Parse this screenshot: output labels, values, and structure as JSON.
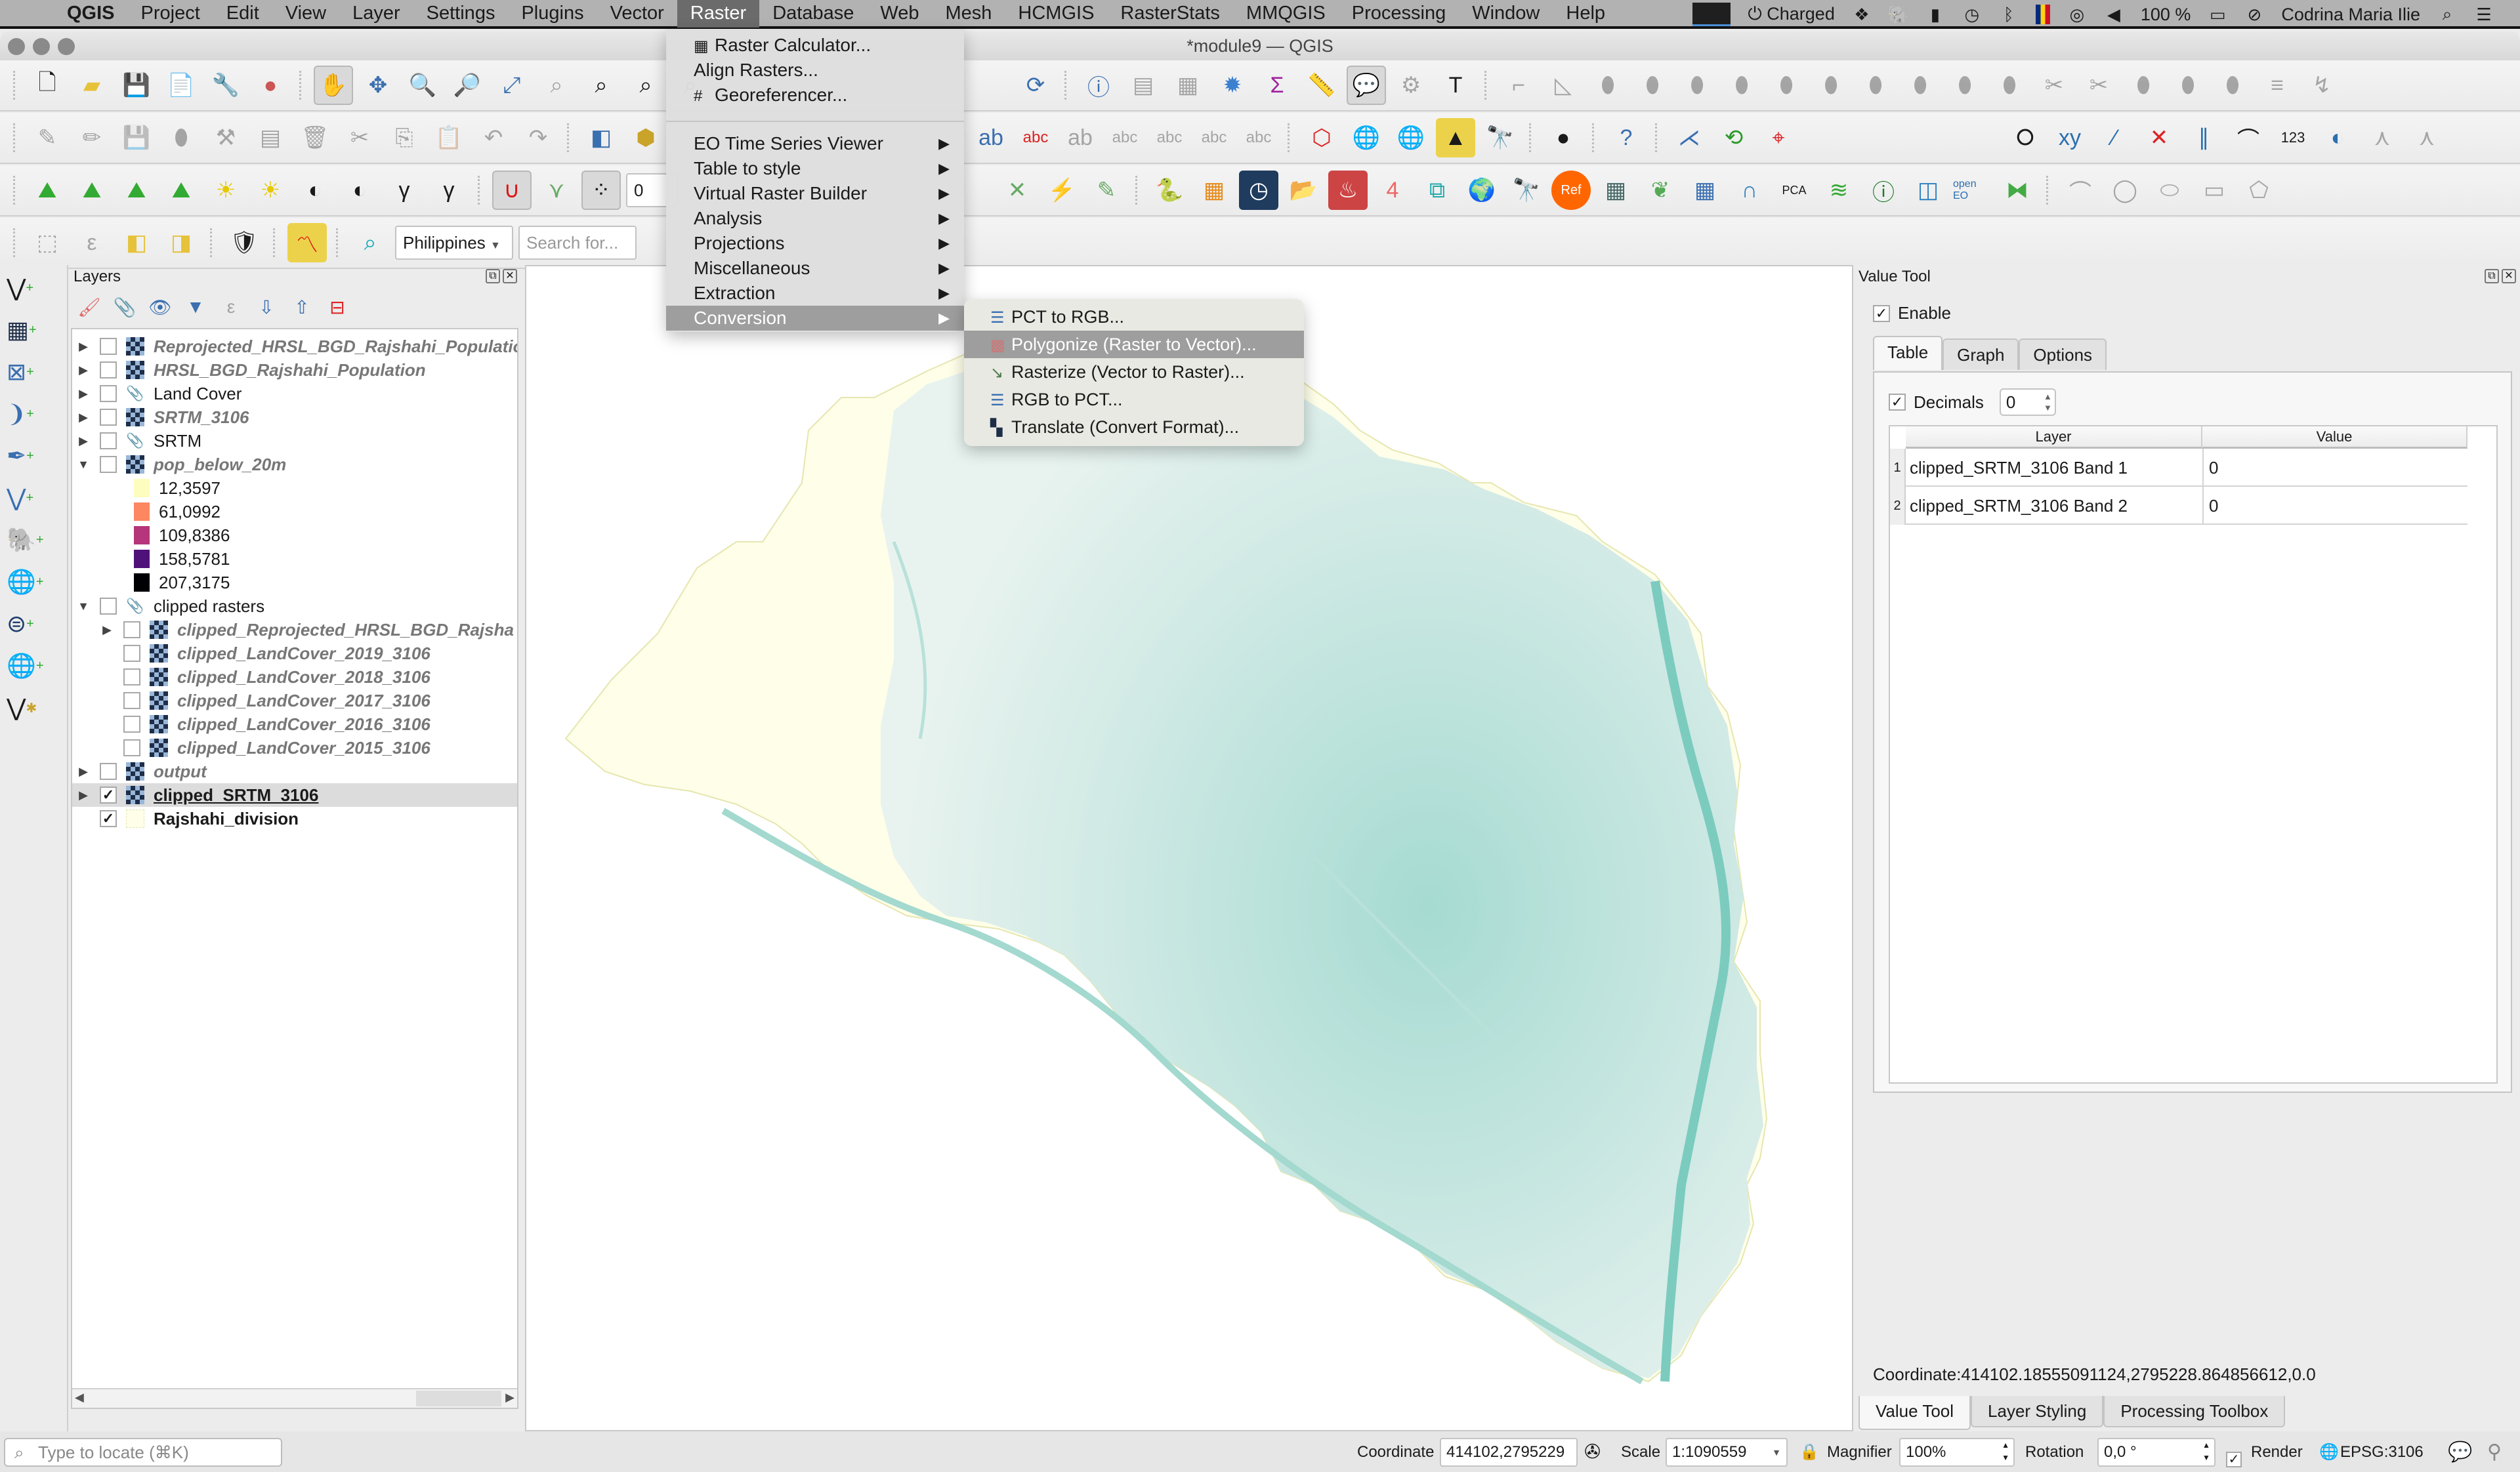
{
  "menubar": {
    "app": "QGIS",
    "items": [
      "Project",
      "Edit",
      "View",
      "Layer",
      "Settings",
      "Plugins",
      "Vector",
      "Raster",
      "Database",
      "Web",
      "Mesh",
      "HCMGIS",
      "RasterStats",
      "MMQGIS",
      "Processing",
      "Window",
      "Help"
    ],
    "active": "Raster",
    "tray": {
      "battery_status": "Charged",
      "battery_pct": "100 %",
      "user": "Codrina Maria Ilie"
    }
  },
  "window": {
    "title": "*module9 — QGIS"
  },
  "toolbar": {
    "locator_country": "Philippines",
    "search_placeholder": "Search for...",
    "tolerance_value": "0"
  },
  "raster_menu": {
    "items": [
      {
        "label": "Raster Calculator...",
        "icon": "raster-calculator-icon"
      },
      {
        "label": "Align Rasters..."
      },
      {
        "label": "Georeferencer...",
        "icon": "georeferencer-icon"
      }
    ],
    "submenus": [
      "EO Time Series Viewer",
      "Table to style",
      "Virtual Raster Builder",
      "Analysis",
      "Projections",
      "Miscellaneous",
      "Extraction",
      "Conversion"
    ],
    "highlighted": "Conversion"
  },
  "conversion_submenu": {
    "items": [
      {
        "label": "PCT to RGB...",
        "icon": "pct-to-rgb-icon"
      },
      {
        "label": "Polygonize (Raster to Vector)...",
        "icon": "polygonize-icon",
        "highlighted": true
      },
      {
        "label": "Rasterize (Vector to Raster)...",
        "icon": "rasterize-icon"
      },
      {
        "label": "RGB to PCT...",
        "icon": "rgb-to-pct-icon"
      },
      {
        "label": "Translate (Convert Format)...",
        "icon": "translate-icon"
      }
    ]
  },
  "layers_panel": {
    "title": "Layers",
    "layers": [
      {
        "name": "Reprojected_HRSL_BGD_Rajshahi_Populatio",
        "type": "raster",
        "checked": false,
        "expand": "collapsed",
        "style": "italic",
        "indent": 0
      },
      {
        "name": "HRSL_BGD_Rajshahi_Population",
        "type": "raster",
        "checked": false,
        "expand": "collapsed",
        "style": "italic",
        "indent": 0
      },
      {
        "name": "Land Cover",
        "type": "group",
        "checked": false,
        "expand": "collapsed",
        "style": "normal",
        "indent": 0
      },
      {
        "name": "SRTM_3106",
        "type": "raster",
        "checked": false,
        "expand": "collapsed",
        "style": "italic",
        "indent": 0
      },
      {
        "name": "SRTM",
        "type": "group",
        "checked": false,
        "expand": "collapsed",
        "style": "normal",
        "indent": 0
      },
      {
        "name": "pop_below_20m",
        "type": "raster",
        "checked": false,
        "expand": "expanded",
        "style": "italic",
        "indent": 0
      }
    ],
    "legend": [
      {
        "value": "12,3597",
        "color": "#fcfdbf"
      },
      {
        "value": "61,0992",
        "color": "#fc8761"
      },
      {
        "value": "109,8386",
        "color": "#b5367a"
      },
      {
        "value": "158,5781",
        "color": "#4f127b"
      },
      {
        "value": "207,3175",
        "color": "#000004"
      }
    ],
    "layers2": [
      {
        "name": "clipped rasters",
        "type": "group",
        "checked": false,
        "expand": "expanded",
        "style": "normal",
        "indent": 0
      },
      {
        "name": "clipped_Reprojected_HRSL_BGD_Rajsha",
        "type": "raster",
        "checked": false,
        "expand": "collapsed",
        "style": "italic",
        "indent": 1
      },
      {
        "name": "clipped_LandCover_2019_3106",
        "type": "raster",
        "checked": false,
        "expand": "none",
        "style": "italic",
        "indent": 1
      },
      {
        "name": "clipped_LandCover_2018_3106",
        "type": "raster",
        "checked": false,
        "expand": "none",
        "style": "italic",
        "indent": 1
      },
      {
        "name": "clipped_LandCover_2017_3106",
        "type": "raster",
        "checked": false,
        "expand": "none",
        "style": "italic",
        "indent": 1
      },
      {
        "name": "clipped_LandCover_2016_3106",
        "type": "raster",
        "checked": false,
        "expand": "none",
        "style": "italic",
        "indent": 1
      },
      {
        "name": "clipped_LandCover_2015_3106",
        "type": "raster",
        "checked": false,
        "expand": "none",
        "style": "italic",
        "indent": 1
      },
      {
        "name": "output",
        "type": "raster",
        "checked": false,
        "expand": "collapsed",
        "style": "italic",
        "indent": 0
      },
      {
        "name": "clipped_SRTM_3106",
        "type": "raster",
        "checked": true,
        "expand": "collapsed",
        "style": "selected",
        "indent": 0
      },
      {
        "name": "Rajshahi_division",
        "type": "vector",
        "checked": true,
        "expand": "none",
        "style": "bold",
        "indent": 0
      }
    ]
  },
  "value_tool": {
    "title": "Value Tool",
    "enable_label": "Enable",
    "enabled": true,
    "tabs": [
      "Table",
      "Graph",
      "Options"
    ],
    "active_tab": "Table",
    "decimals_label": "Decimals",
    "decimals_checked": true,
    "decimals_value": "0",
    "columns": [
      "Layer",
      "Value"
    ],
    "rows": [
      {
        "index": "1",
        "layer": "clipped_SRTM_3106 Band 1",
        "value": "0"
      },
      {
        "index": "2",
        "layer": "clipped_SRTM_3106 Band 2",
        "value": "0"
      }
    ],
    "coordinate": "Coordinate:414102.18555091124,2795228.864856612,0.0"
  },
  "dock_tabs": [
    "Value Tool",
    "Layer Styling",
    "Processing Toolbox"
  ],
  "status_bar": {
    "locate_placeholder": "Type to locate (⌘K)",
    "coordinate_label": "Coordinate",
    "coordinate_value": "414102,2795229",
    "scale_label": "Scale",
    "scale_value": "1:1090559",
    "magnifier_label": "Magnifier",
    "magnifier_value": "100%",
    "rotation_label": "Rotation",
    "rotation_value": "0,0 °",
    "render_label": "Render",
    "render_checked": true,
    "crs": "EPSG:3106"
  },
  "map": {
    "colors": {
      "low": "#fefee9",
      "high": "#7ccbbf",
      "mid": "#d6ece8"
    }
  }
}
